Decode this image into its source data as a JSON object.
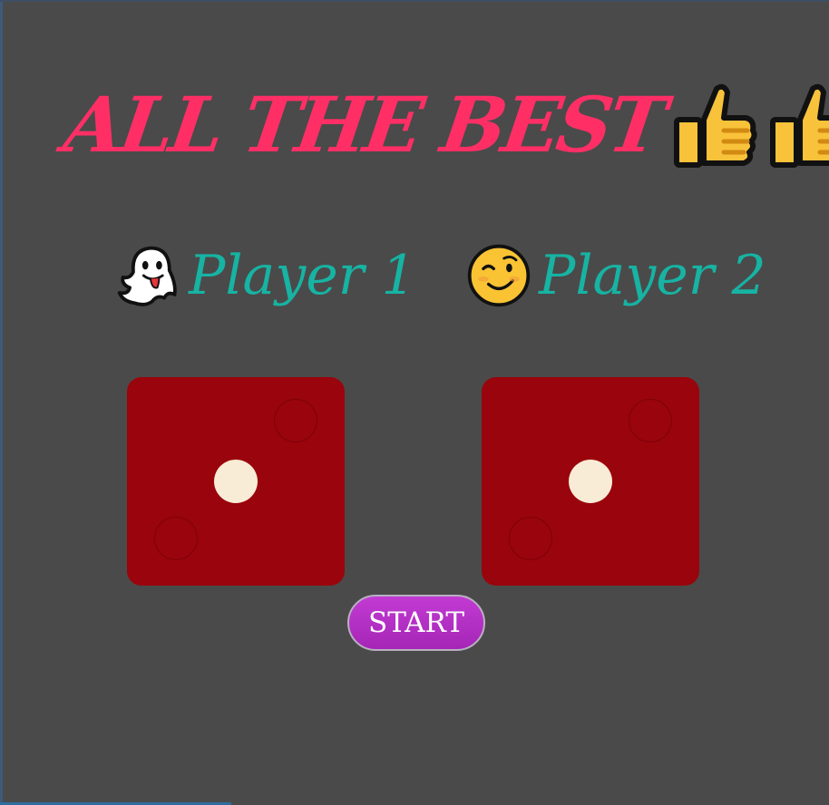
{
  "header": {
    "title": "ALL THE BEST",
    "icons": [
      "thumbs-up-icon",
      "thumbs-up-icon"
    ]
  },
  "players": [
    {
      "label": "Player 1",
      "icon": "ghost-icon"
    },
    {
      "label": "Player 2",
      "icon": "winking-face-icon"
    }
  ],
  "dice": [
    {
      "value": 1
    },
    {
      "value": 1
    }
  ],
  "controls": {
    "start_label": "START"
  },
  "colors": {
    "background": "#4a4a4a",
    "title": "#ff2f66",
    "player_label": "#17b3a3",
    "die_face": "#9a040c",
    "pip": "#f9ecd6",
    "button": "#b52ec6"
  }
}
